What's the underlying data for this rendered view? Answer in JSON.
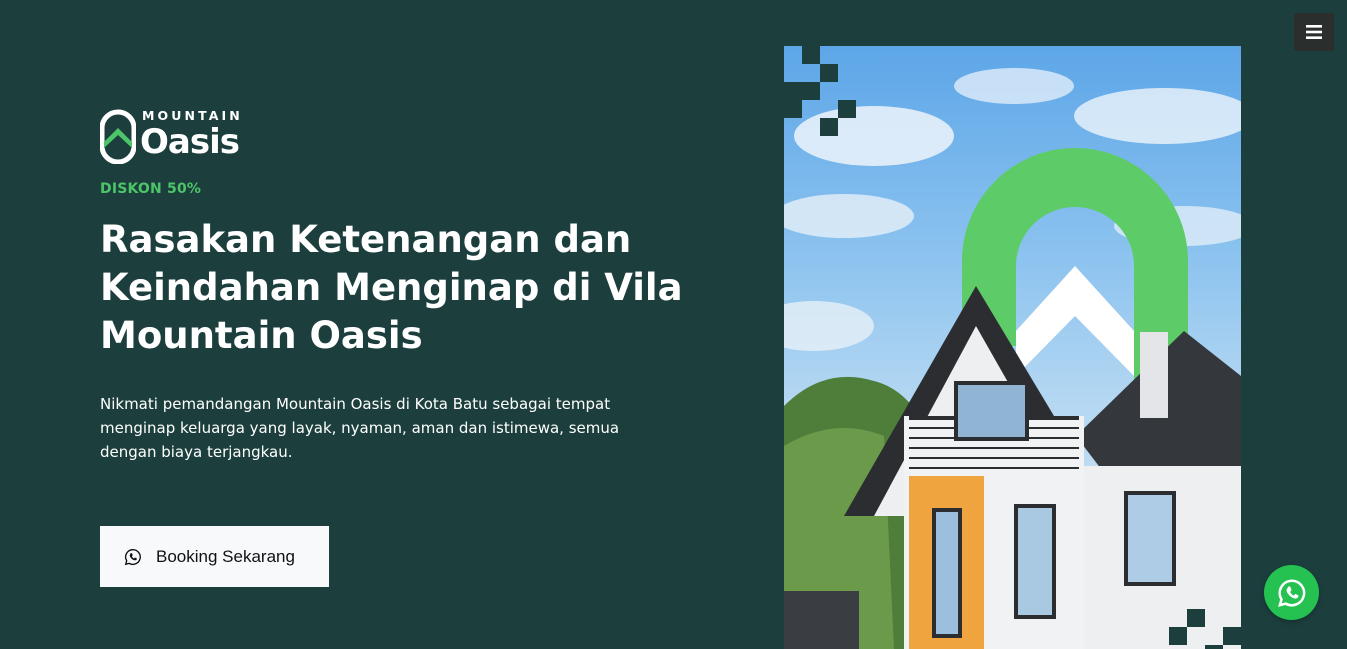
{
  "brand": {
    "logo_top": "MOUNTAIN",
    "logo_bottom": "Oasis",
    "accent": "#4cc569",
    "background": "#1c3f3e"
  },
  "hero": {
    "badge": "DISKON 50%",
    "headline_line1": "Rasakan Ketenangan dan",
    "headline_line2": "Keindahan Menginap di Vila",
    "headline_line3": "Mountain Oasis",
    "description": "Nikmati pemandangan Mountain Oasis di Kota Batu sebagai tempat menginap keluarga yang layak, nyaman, aman dan istimewa, semua dengan biaya terjangkau.",
    "cta_label": "Booking Sekarang",
    "cta_icon": "whatsapp-icon"
  },
  "nav": {
    "menu_icon": "hamburger-icon"
  },
  "floating": {
    "whatsapp_icon": "whatsapp-icon",
    "color": "#25c252"
  }
}
